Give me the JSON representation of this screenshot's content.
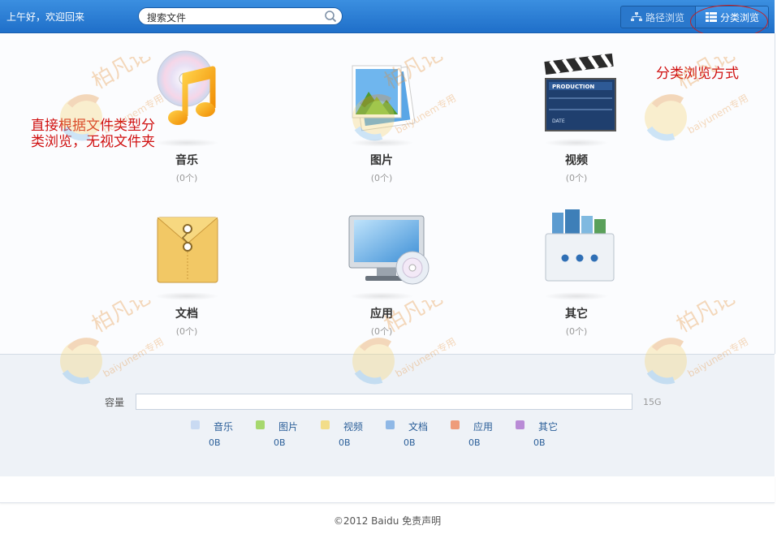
{
  "header": {
    "greeting": "上午好，欢迎回来",
    "search_placeholder": "搜索文件",
    "tabs": [
      {
        "label": "路径浏览",
        "icon": "tree-icon",
        "active": false
      },
      {
        "label": "分类浏览",
        "icon": "list-icon",
        "active": true
      }
    ]
  },
  "categories": [
    {
      "name": "音乐",
      "count": "(0个)",
      "icon": "music-icon"
    },
    {
      "name": "图片",
      "count": "(0个)",
      "icon": "picture-icon"
    },
    {
      "name": "视频",
      "count": "(0个)",
      "icon": "video-icon"
    },
    {
      "name": "文档",
      "count": "(0个)",
      "icon": "document-icon"
    },
    {
      "name": "应用",
      "count": "(0个)",
      "icon": "application-icon"
    },
    {
      "name": "其它",
      "count": "(0个)",
      "icon": "other-icon"
    }
  ],
  "annotations": {
    "note_left": "直接根据文件类型分类浏览，无视文件夹",
    "note_right": "分类浏览方式"
  },
  "storage": {
    "label": "容量",
    "total": "15G",
    "used_fraction": 0,
    "legend": [
      {
        "name": "音乐",
        "size": "0B",
        "color": "#c9daf2"
      },
      {
        "name": "图片",
        "size": "0B",
        "color": "#a6d86e"
      },
      {
        "name": "视频",
        "size": "0B",
        "color": "#f2dd8a"
      },
      {
        "name": "文档",
        "size": "0B",
        "color": "#8fb8e6"
      },
      {
        "name": "应用",
        "size": "0B",
        "color": "#ee9c7a"
      },
      {
        "name": "其它",
        "size": "0B",
        "color": "#b98bd6"
      }
    ]
  },
  "watermark": {
    "brand": "柏凡论坛",
    "sub": "baiyunem专用"
  },
  "footer": {
    "copyright": "©2012 Baidu",
    "link": "免责声明"
  }
}
